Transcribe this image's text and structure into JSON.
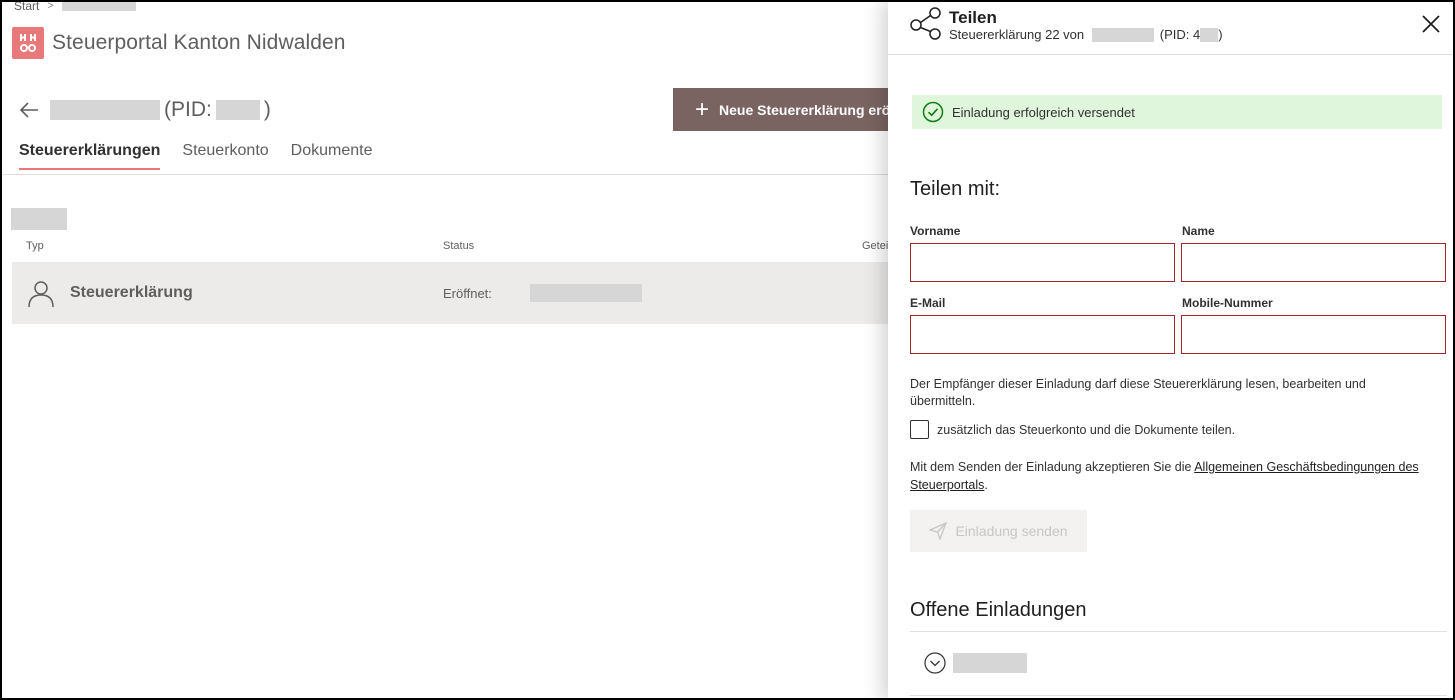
{
  "breadcrumb": {
    "start": "Start",
    "separator": ">"
  },
  "brand": {
    "title": "Steuerportal Kanton Nidwalden"
  },
  "person": {
    "pid_prefix": "(PID:",
    "pid_suffix": ")"
  },
  "new_button": {
    "label": "Neue Steuererklärung eröffnen"
  },
  "tabs": [
    {
      "label": "Steuererklärungen",
      "active": true
    },
    {
      "label": "Steuerkonto",
      "active": false
    },
    {
      "label": "Dokumente",
      "active": false
    }
  ],
  "table": {
    "columns": {
      "type": "Typ",
      "status": "Status",
      "shared": "Geteilt"
    },
    "row": {
      "type": "Steuererklärung",
      "status_label": "Eröffnet:"
    }
  },
  "panel": {
    "title": "Teilen",
    "subtitle_prefix": "Steuererklärung 22 von",
    "subtitle_pid": "(PID: 4",
    "subtitle_suffix": ")",
    "success_message": "Einladung erfolgreich versendet",
    "share_with_heading": "Teilen mit:",
    "fields": {
      "first_name_label": "Vorname",
      "last_name_label": "Name",
      "email_label": "E-Mail",
      "mobile_label": "Mobile-Nummer"
    },
    "info_text": "Der Empfänger dieser Einladung darf diese Steuererklärung lesen, bearbeiten und übermitteln.",
    "checkbox_label": "zusätzlich das Steuerkonto und die Dokumente teilen.",
    "terms_prefix": "Mit dem Senden der Einladung akzeptieren Sie die ",
    "terms_link": "Allgemeinen Geschäftsbedingungen des Steuerportals",
    "terms_suffix": ".",
    "send_button": "Einladung senden",
    "open_invitations_heading": "Offene Einladungen"
  },
  "colors": {
    "brand_accent": "#e8787a",
    "primary_button": "#7a6462",
    "success_bg": "#dff6dd",
    "success_icon": "#107c10",
    "field_error_border": "#a4262c"
  },
  "icons": {
    "logo": "canton-logo-icon",
    "back": "arrow-left-icon",
    "plus": "plus-icon",
    "person": "person-icon",
    "share": "share-icon",
    "close": "close-icon",
    "success": "check-circle-icon",
    "send": "send-icon",
    "expand": "chevron-down-circle-icon"
  }
}
